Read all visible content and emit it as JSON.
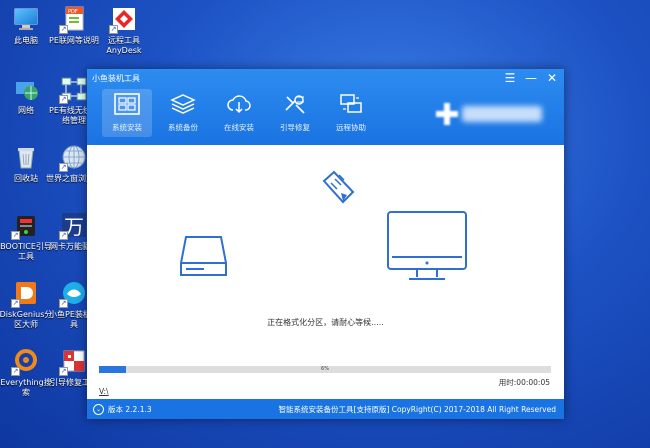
{
  "desktop": {
    "icons": [
      {
        "label": "此电脑"
      },
      {
        "label": "PE联网等说明"
      },
      {
        "label": "远程工具\nAnyDesk"
      },
      {
        "label": "网络"
      },
      {
        "label": "PE有线无线网络管理"
      },
      {
        "label": "回收站"
      },
      {
        "label": "世界之窗浏览器"
      },
      {
        "label": "BOOTICE引导工具"
      },
      {
        "label": "网卡万能驱动"
      },
      {
        "label": "DiskGenius分区大师"
      },
      {
        "label": "小鱼PE装机工具"
      },
      {
        "label": "Everything搜索"
      },
      {
        "label": "引导修复工具"
      }
    ]
  },
  "window": {
    "title": "小鱼装机工具",
    "controls": {
      "menu": "☰",
      "minimize": "—",
      "close": "✕"
    },
    "nav": [
      {
        "label": "系统安装",
        "icon": "windows-icon",
        "active": true
      },
      {
        "label": "系统备份",
        "icon": "layers-icon",
        "active": false
      },
      {
        "label": "在线安装",
        "icon": "cloud-download-icon",
        "active": false
      },
      {
        "label": "引导修复",
        "icon": "tools-icon",
        "active": false
      },
      {
        "label": "远程协助",
        "icon": "remote-icon",
        "active": false
      }
    ],
    "body": {
      "status": "正在格式化分区，请耐心等候.....",
      "progress": {
        "value": 6,
        "label": "6%"
      },
      "timer": "用时:00:00:05",
      "drive": "V:\\"
    },
    "footer": {
      "version": "版本 2.2.1.3",
      "copyright": "智能系统安装备份工具[支持原版]  CopyRight(C) 2017-2018 All Right Reserved"
    },
    "colors": {
      "accent": "#1a73e2",
      "progress": "#2a76dc",
      "illustration": "#2f6fd1"
    }
  }
}
